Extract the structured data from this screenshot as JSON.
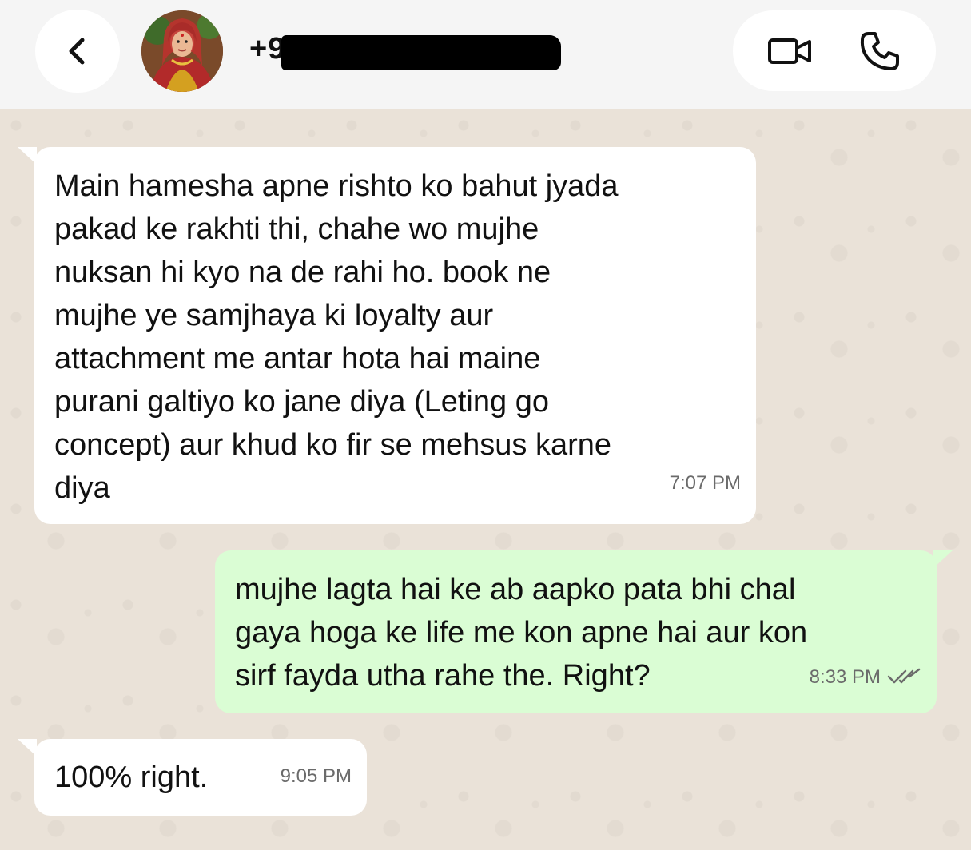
{
  "header": {
    "contact_name": "+9",
    "icons": {
      "back": "chevron-left-icon",
      "video": "video-call-icon",
      "voice": "phone-icon"
    }
  },
  "messages": [
    {
      "direction": "incoming",
      "text": "Main hamesha apne rishto ko bahut jyada\npakad ke rakhti thi, chahe wo mujhe\nnuksan hi kyo na de rahi ho. book ne\nmujhe ye samjhaya ki loyalty aur\nattachment me antar hota hai maine\npurani galtiyo ko jane diya (Leting go\nconcept) aur khud ko fir se mehsus karne\ndiya",
      "time": "7:07 PM"
    },
    {
      "direction": "outgoing",
      "text": "mujhe lagta hai ke ab aapko pata bhi chal\ngaya hoga ke life me kon apne hai aur kon\nsirf fayda utha rahe the. Right?",
      "time": "8:33 PM",
      "status": "read-double-check-icon"
    },
    {
      "direction": "incoming",
      "text": "100% right.",
      "time": "9:05 PM"
    }
  ],
  "colors": {
    "incoming_bubble": "#ffffff",
    "outgoing_bubble": "#dafdd4",
    "wallpaper": "#eae2d8",
    "header": "#f5f5f5"
  }
}
